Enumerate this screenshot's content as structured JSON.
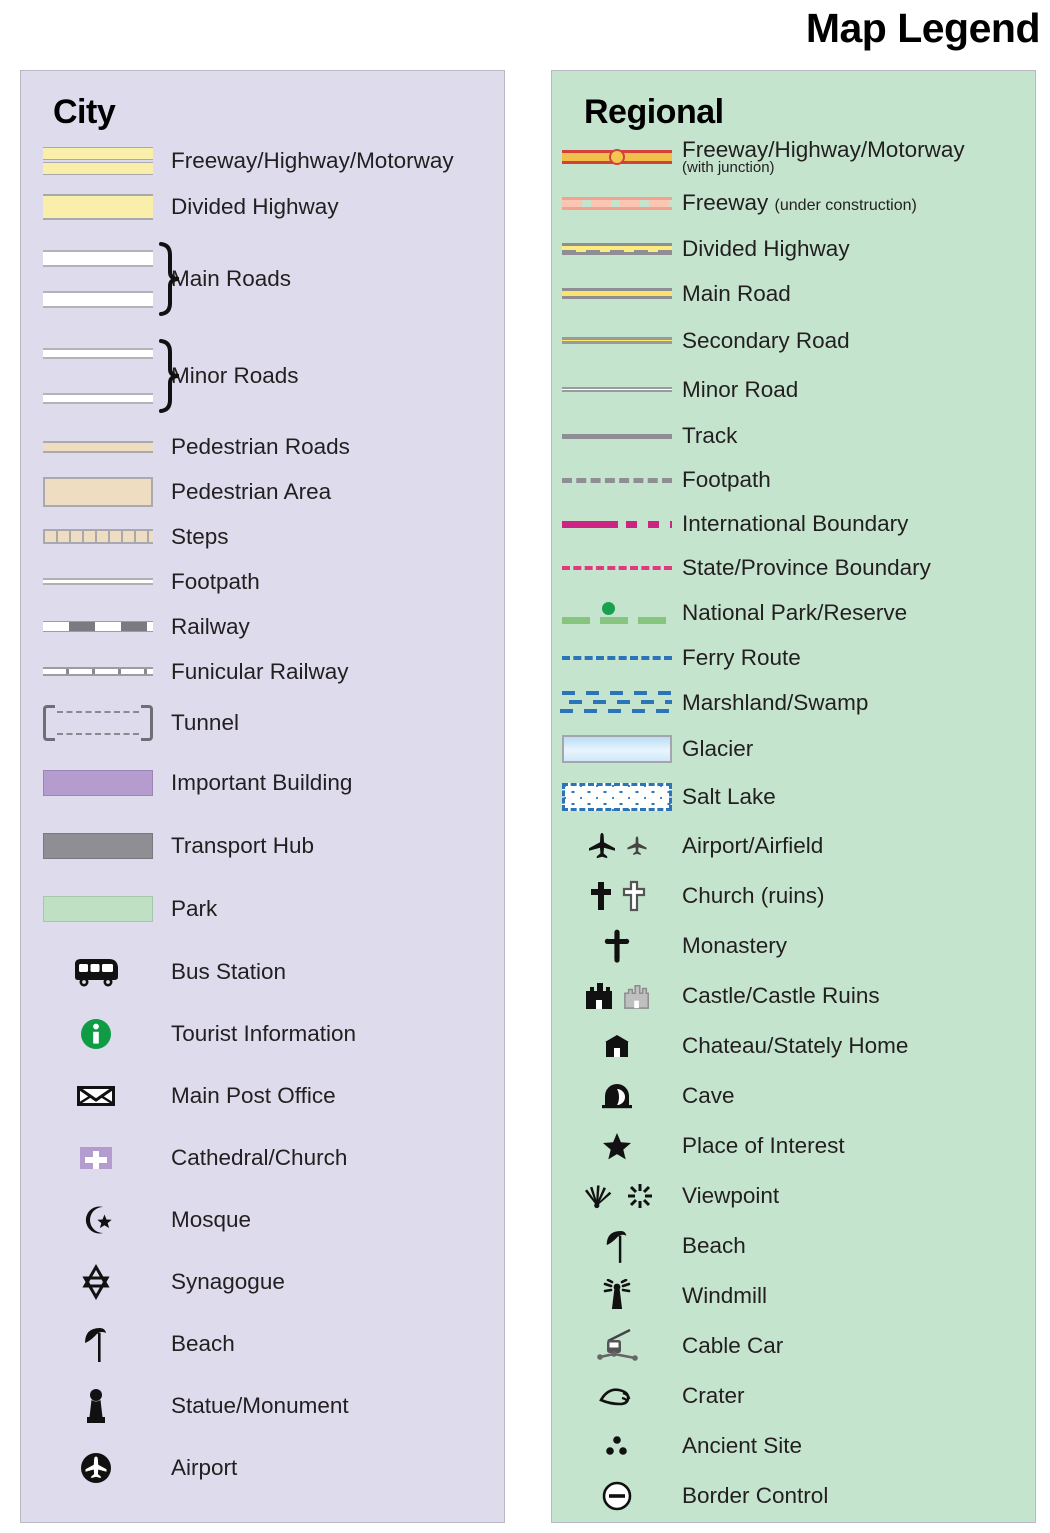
{
  "title": "Map Legend",
  "city": {
    "heading": "City",
    "items": [
      {
        "label": "Freeway/Highway/Motorway",
        "symbol": "city-freeway-swatch"
      },
      {
        "label": "Divided Highway",
        "symbol": "city-divided-highway-swatch"
      },
      {
        "label": "Main Roads",
        "symbol": "city-main-roads-swatch"
      },
      {
        "label": "Minor Roads",
        "symbol": "city-minor-roads-swatch"
      },
      {
        "label": "Pedestrian Roads",
        "symbol": "city-pedestrian-road-swatch"
      },
      {
        "label": "Pedestrian Area",
        "symbol": "city-pedestrian-area-swatch"
      },
      {
        "label": "Steps",
        "symbol": "city-steps-swatch"
      },
      {
        "label": "Footpath",
        "symbol": "city-footpath-swatch"
      },
      {
        "label": "Railway",
        "symbol": "city-railway-swatch"
      },
      {
        "label": "Funicular Railway",
        "symbol": "city-funicular-swatch"
      },
      {
        "label": "Tunnel",
        "symbol": "city-tunnel-swatch"
      },
      {
        "label": "Important Building",
        "symbol": "city-important-building-swatch"
      },
      {
        "label": "Transport Hub",
        "symbol": "city-transport-hub-swatch"
      },
      {
        "label": "Park",
        "symbol": "city-park-swatch"
      },
      {
        "label": "Bus Station",
        "symbol": "bus-icon"
      },
      {
        "label": "Tourist Information",
        "symbol": "info-icon"
      },
      {
        "label": "Main Post Office",
        "symbol": "envelope-icon"
      },
      {
        "label": "Cathedral/Church",
        "symbol": "church-cross-icon"
      },
      {
        "label": "Mosque",
        "symbol": "crescent-star-icon"
      },
      {
        "label": "Synagogue",
        "symbol": "star-of-david-icon"
      },
      {
        "label": "Beach",
        "symbol": "beach-umbrella-icon"
      },
      {
        "label": "Statue/Monument",
        "symbol": "statue-icon"
      },
      {
        "label": "Airport",
        "symbol": "airport-circle-icon"
      }
    ],
    "colors": {
      "panel_background": "#dedcec",
      "highway_fill": "#faeeab",
      "pedestrian_fill": "#eeddc0",
      "important_building": "#b49ccf",
      "transport_hub": "#8e8e94",
      "park": "#bfe0c3",
      "tourist_info": "#0f9c44"
    }
  },
  "regional": {
    "heading": "Regional",
    "items": [
      {
        "label": "Freeway/Highway/Motorway",
        "sublabel": "(with junction)",
        "sub_style": "below",
        "symbol": "regional-freeway-junction-swatch"
      },
      {
        "label": "Freeway",
        "sublabel": "(under construction)",
        "sub_style": "inline",
        "symbol": "regional-freeway-construction-swatch"
      },
      {
        "label": "Divided Highway",
        "symbol": "regional-divided-highway-swatch"
      },
      {
        "label": "Main Road",
        "symbol": "regional-main-road-swatch"
      },
      {
        "label": "Secondary Road",
        "symbol": "regional-secondary-road-swatch"
      },
      {
        "label": "Minor Road",
        "symbol": "regional-minor-road-swatch"
      },
      {
        "label": "Track",
        "symbol": "regional-track-swatch"
      },
      {
        "label": "Footpath",
        "symbol": "regional-footpath-swatch"
      },
      {
        "label": "International Boundary",
        "symbol": "regional-international-boundary-swatch"
      },
      {
        "label": "State/Province Boundary",
        "symbol": "regional-state-boundary-swatch"
      },
      {
        "label": "National Park/Reserve",
        "symbol": "regional-national-park-swatch"
      },
      {
        "label": "Ferry Route",
        "symbol": "regional-ferry-route-swatch"
      },
      {
        "label": "Marshland/Swamp",
        "symbol": "regional-marshland-swatch"
      },
      {
        "label": "Glacier",
        "symbol": "regional-glacier-swatch"
      },
      {
        "label": "Salt Lake",
        "symbol": "regional-salt-lake-swatch"
      },
      {
        "label": "Airport/Airfield",
        "symbol": "plane-icon-pair"
      },
      {
        "label": "Church (ruins)",
        "symbol": "cross-icon-pair"
      },
      {
        "label": "Monastery",
        "symbol": "monastery-cross-icon"
      },
      {
        "label": "Castle/Castle Ruins",
        "symbol": "castle-icon-pair"
      },
      {
        "label": "Chateau/Stately Home",
        "symbol": "chateau-icon"
      },
      {
        "label": "Cave",
        "symbol": "cave-icon"
      },
      {
        "label": "Place of Interest",
        "symbol": "star-icon"
      },
      {
        "label": "Viewpoint",
        "symbol": "viewpoint-icon-pair"
      },
      {
        "label": "Beach",
        "symbol": "beach-umbrella-icon"
      },
      {
        "label": "Windmill",
        "symbol": "windmill-icon"
      },
      {
        "label": "Cable Car",
        "symbol": "cable-car-icon"
      },
      {
        "label": "Crater",
        "symbol": "crater-icon"
      },
      {
        "label": "Ancient Site",
        "symbol": "ancient-site-icon"
      },
      {
        "label": "Border Control",
        "symbol": "border-control-icon"
      }
    ],
    "colors": {
      "panel_background": "#c5e4ce",
      "freeway_outline": "#d4403c",
      "freeway_fill": "#f0c04a",
      "under_construction": "#f9c6b4",
      "main_road_fill": "#fbe46d",
      "secondary_road_fill": "#fbea5a",
      "track_gray": "#8e8e94",
      "international_boundary": "#cc2483",
      "state_boundary": "#e0397f",
      "national_park": "#86c47f",
      "national_park_dot": "#17a04e",
      "ferry_route": "#2b74b8",
      "marshland": "#2b74b8",
      "glacier": "#b9ddf5",
      "salt_lake": "#2b74b8"
    }
  }
}
